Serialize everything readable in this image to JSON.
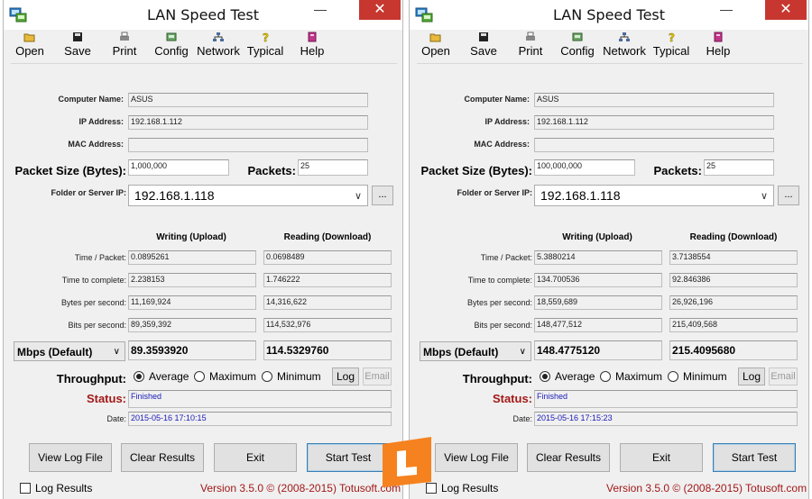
{
  "windows": [
    {
      "title": "LAN Speed Test",
      "toolbar": [
        "Open",
        "Save",
        "Print",
        "Config",
        "Network",
        "Typical",
        "Help"
      ],
      "computer_name_label": "Computer Name:",
      "computer_name": "ASUS",
      "ip_label": "IP Address:",
      "ip": "192.168.1.112",
      "mac_label": "MAC Address:",
      "mac": "",
      "packet_size_label": "Packet Size (Bytes):",
      "packet_size": "1,000,000",
      "packets_label": "Packets:",
      "packets": "25",
      "folder_label": "Folder or Server IP:",
      "folder": "192.168.1.118",
      "browse": "...",
      "writing_header": "Writing (Upload)",
      "reading_header": "Reading (Download)",
      "rows": [
        {
          "label": "Time / Packet:",
          "write": "0.0895261",
          "read": "0.0698489"
        },
        {
          "label": "Time to complete:",
          "write": "2.238153",
          "read": "1.746222"
        },
        {
          "label": "Bytes per second:",
          "write": "11,169,924",
          "read": "14,316,622"
        },
        {
          "label": "Bits per second:",
          "write": "89,359,392",
          "read": "114,532,976"
        }
      ],
      "unit": "Mbps (Default)",
      "mbps_write": "89.3593920",
      "mbps_read": "114.5329760",
      "throughput_label": "Throughput:",
      "radio_average": "Average",
      "radio_maximum": "Maximum",
      "radio_minimum": "Minimum",
      "log_btn": "Log",
      "email_btn": "Email",
      "status_label": "Status:",
      "status": "Finished",
      "date_label": "Date:",
      "date": "2015-05-16 17:10:15",
      "view_log": "View Log File",
      "clear": "Clear Results",
      "exit": "Exit",
      "start": "Start Test",
      "log_results": "Log Results",
      "version": "Version 3.5.0  © (2008-2015) Totusoft.com"
    },
    {
      "title": "LAN Speed Test",
      "toolbar": [
        "Open",
        "Save",
        "Print",
        "Config",
        "Network",
        "Typical",
        "Help"
      ],
      "computer_name_label": "Computer Name:",
      "computer_name": "ASUS",
      "ip_label": "IP Address:",
      "ip": "192.168.1.112",
      "mac_label": "MAC Address:",
      "mac": "",
      "packet_size_label": "Packet Size (Bytes):",
      "packet_size": "100,000,000",
      "packets_label": "Packets:",
      "packets": "25",
      "folder_label": "Folder or Server IP:",
      "folder": "192.168.1.118",
      "browse": "...",
      "writing_header": "Writing (Upload)",
      "reading_header": "Reading (Download)",
      "rows": [
        {
          "label": "Time / Packet:",
          "write": "5.3880214",
          "read": "3.7138554"
        },
        {
          "label": "Time to complete:",
          "write": "134.700536",
          "read": "92.846386"
        },
        {
          "label": "Bytes per second:",
          "write": "18,559,689",
          "read": "26,926,196"
        },
        {
          "label": "Bits per second:",
          "write": "148,477,512",
          "read": "215,409,568"
        }
      ],
      "unit": "Mbps (Default)",
      "mbps_write": "148.4775120",
      "mbps_read": "215.4095680",
      "throughput_label": "Throughput:",
      "radio_average": "Average",
      "radio_maximum": "Maximum",
      "radio_minimum": "Minimum",
      "log_btn": "Log",
      "email_btn": "Email",
      "status_label": "Status:",
      "status": "Finished",
      "date_label": "Date:",
      "date": "2015-05-16 17:15:23",
      "view_log": "View Log File",
      "clear": "Clear Results",
      "exit": "Exit",
      "start": "Start Test",
      "log_results": "Log Results",
      "version": "Version 3.5.0  © (2008-2015) Totusoft.com"
    }
  ],
  "icons": {
    "toolbar": [
      "folder-open-icon",
      "floppy-disk-icon",
      "printer-icon",
      "config-icon",
      "network-icon",
      "help-bulb-icon",
      "help-book-icon"
    ]
  },
  "colors": {
    "status_red": "#a31818",
    "close_button": "#c7372f",
    "status_text": "#1a1ab8",
    "watermark_orange": "#f5821f"
  }
}
